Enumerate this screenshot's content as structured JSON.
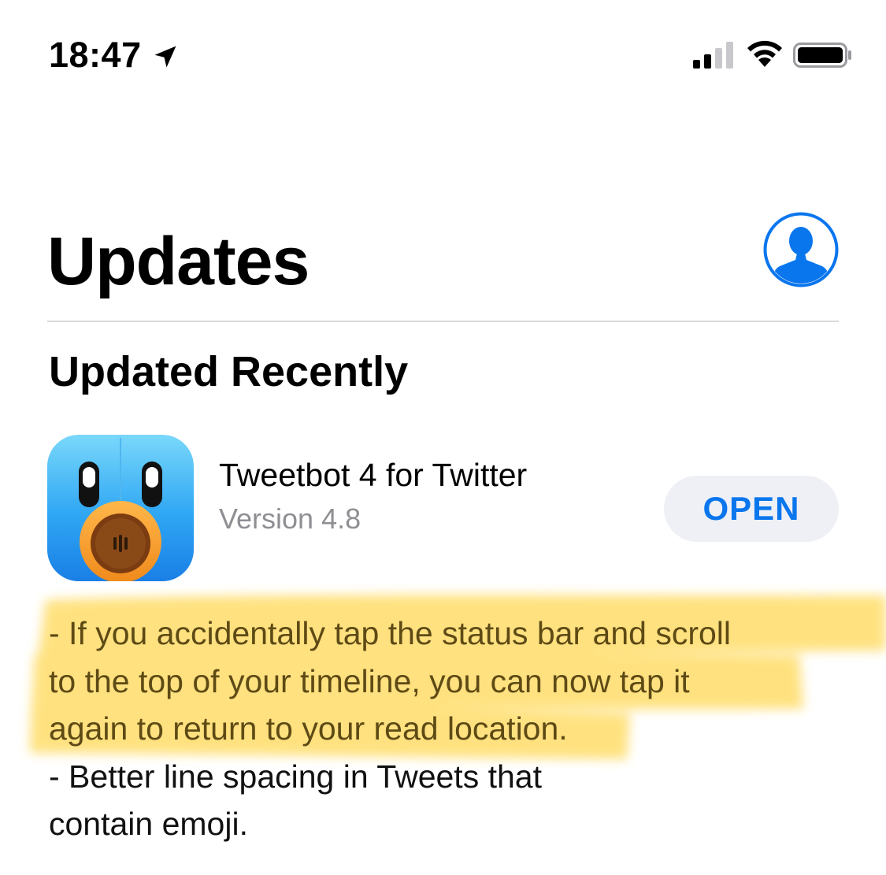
{
  "status_bar": {
    "time": "18:47",
    "location_icon": "location-arrow-icon",
    "signal_icon": "cellular-signal-icon",
    "signal_bars_active": 2,
    "signal_bars_total": 4,
    "wifi_icon": "wifi-icon",
    "battery_icon": "battery-icon",
    "battery_level": 1.0
  },
  "header": {
    "title": "Updates",
    "account_icon": "account-avatar-icon"
  },
  "section": {
    "title": "Updated Recently"
  },
  "app": {
    "name": "Tweetbot 4 for Twitter",
    "version": "Version 4.8",
    "action_label": "OPEN",
    "icon": "tweetbot-app-icon"
  },
  "release_notes": {
    "lines": [
      "- If you accidentally tap the status bar and scroll",
      "to the top of your timeline, you can now tap it",
      "again to return to your read location.",
      "- Better line spacing in Tweets that",
      "contain emoji."
    ]
  },
  "colors": {
    "accent": "#0a76ee",
    "secondary_text": "#8e8e93",
    "button_bg": "#eef0f5",
    "highlighter": "#ffd54a"
  }
}
